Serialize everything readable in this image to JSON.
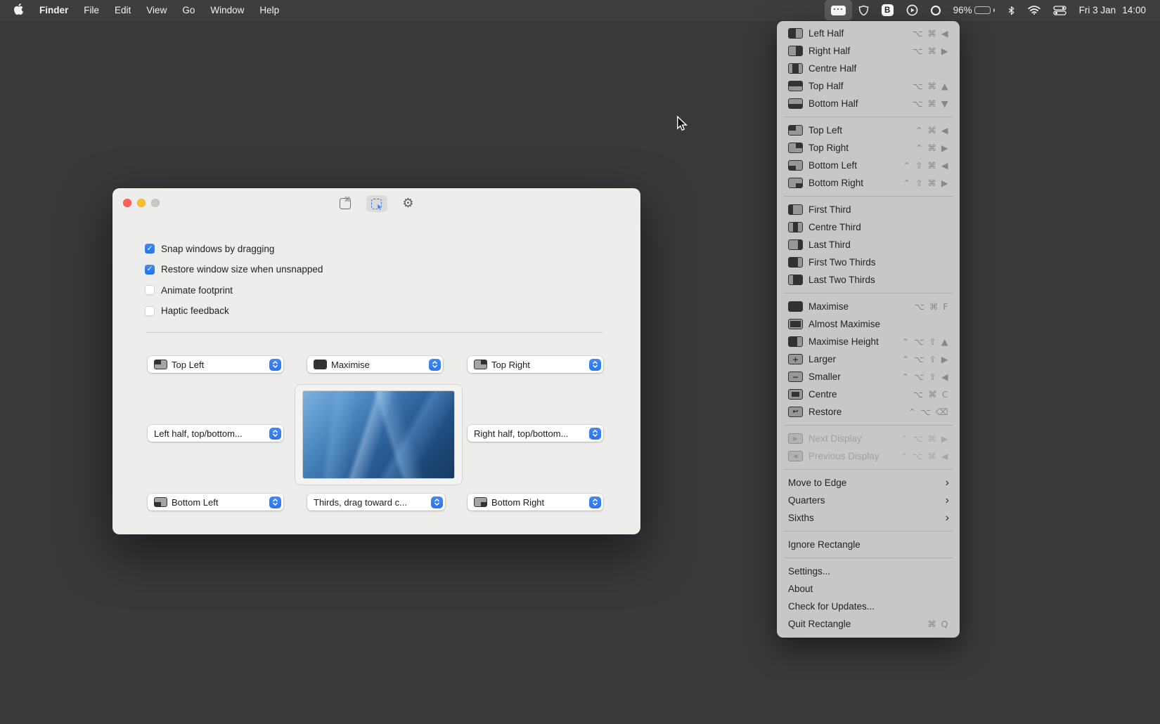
{
  "menubar": {
    "items": [
      "Finder",
      "File",
      "Edit",
      "View",
      "Go",
      "Window",
      "Help"
    ],
    "status": {
      "battery": "96%",
      "date": "Fri 3 Jan",
      "time": "14:00"
    }
  },
  "rect_menu": {
    "submenu_arrow": "›",
    "sections": [
      {
        "items": [
          {
            "label": "Left Half",
            "shortcut": "⌥ ⌘ ◀",
            "icon": "left-half"
          },
          {
            "label": "Right Half",
            "shortcut": "⌥ ⌘ ▶",
            "icon": "right-half"
          },
          {
            "label": "Centre Half",
            "shortcut": "",
            "icon": "centre-half"
          },
          {
            "label": "Top Half",
            "shortcut": "⌥ ⌘ ▲",
            "icon": "top-half"
          },
          {
            "label": "Bottom Half",
            "shortcut": "⌥ ⌘ ▼",
            "icon": "bottom-half"
          }
        ]
      },
      {
        "items": [
          {
            "label": "Top Left",
            "shortcut": "⌃ ⌘ ◀",
            "icon": "top-left"
          },
          {
            "label": "Top Right",
            "shortcut": "⌃ ⌘ ▶",
            "icon": "top-right"
          },
          {
            "label": "Bottom Left",
            "shortcut": "⌃ ⇧ ⌘ ◀",
            "icon": "bottom-left"
          },
          {
            "label": "Bottom Right",
            "shortcut": "⌃ ⇧ ⌘ ▶",
            "icon": "bottom-right"
          }
        ]
      },
      {
        "items": [
          {
            "label": "First Third",
            "shortcut": "",
            "icon": "first-third"
          },
          {
            "label": "Centre Third",
            "shortcut": "",
            "icon": "centre-third"
          },
          {
            "label": "Last Third",
            "shortcut": "",
            "icon": "last-third"
          },
          {
            "label": "First Two Thirds",
            "shortcut": "",
            "icon": "first-two-thirds"
          },
          {
            "label": "Last Two Thirds",
            "shortcut": "",
            "icon": "last-two-thirds"
          }
        ]
      },
      {
        "items": [
          {
            "label": "Maximise",
            "shortcut": "⌥ ⌘ F",
            "icon": "maximise"
          },
          {
            "label": "Almost Maximise",
            "shortcut": "",
            "icon": "almost-maximise"
          },
          {
            "label": "Maximise Height",
            "shortcut": "⌃ ⌥ ⇧ ▲",
            "icon": "maximise-height"
          },
          {
            "label": "Larger",
            "shortcut": "⌃ ⌥ ⇧ ▶",
            "icon": "larger"
          },
          {
            "label": "Smaller",
            "shortcut": "⌃ ⌥ ⇧ ◀",
            "icon": "smaller"
          },
          {
            "label": "Centre",
            "shortcut": "⌥ ⌘ C",
            "icon": "centre"
          },
          {
            "label": "Restore",
            "shortcut": "⌃ ⌥ ⌫",
            "icon": "restore"
          }
        ]
      },
      {
        "items": [
          {
            "label": "Next Display",
            "shortcut": "⌃ ⌥ ⌘ ▶",
            "icon": "next-display",
            "disabled": true
          },
          {
            "label": "Previous Display",
            "shortcut": "⌃ ⌥ ⌘ ◀",
            "icon": "prev-display",
            "disabled": true
          }
        ]
      },
      {
        "items": [
          {
            "label": "Move to Edge",
            "submenu": true
          },
          {
            "label": "Quarters",
            "submenu": true
          },
          {
            "label": "Sixths",
            "submenu": true
          }
        ]
      },
      {
        "items": [
          {
            "label": "Ignore Rectangle"
          }
        ]
      },
      {
        "items": [
          {
            "label": "Settings..."
          },
          {
            "label": "About"
          },
          {
            "label": "Check for Updates..."
          },
          {
            "label": "Quit Rectangle",
            "shortcut": "⌘ Q"
          }
        ]
      }
    ]
  },
  "window": {
    "checkboxes": [
      {
        "label": "Snap windows by dragging",
        "checked": true
      },
      {
        "label": "Restore window size when unsnapped",
        "checked": true
      },
      {
        "label": "Animate footprint",
        "checked": false
      },
      {
        "label": "Haptic feedback",
        "checked": false
      }
    ],
    "popups": {
      "top_left": {
        "label": "Top Left",
        "icon": "top-left"
      },
      "maximise": {
        "label": "Maximise",
        "icon": "maximise"
      },
      "top_right": {
        "label": "Top Right",
        "icon": "top-right"
      },
      "left_half": {
        "label": "Left half, top/bottom..."
      },
      "right_half": {
        "label": "Right half, top/bottom..."
      },
      "bottom_left": {
        "label": "Bottom Left",
        "icon": "bottom-left"
      },
      "thirds": {
        "label": "Thirds, drag toward c..."
      },
      "bottom_right": {
        "label": "Bottom Right",
        "icon": "bottom-right"
      }
    }
  },
  "colors": {
    "accent_blue": "#2f7cf7",
    "battery_yellow": "#f2c324",
    "traffic_red": "#ff5f57",
    "traffic_yellow": "#febc2e",
    "menu_bg": "#cacacd",
    "desktop": "#39393b"
  }
}
